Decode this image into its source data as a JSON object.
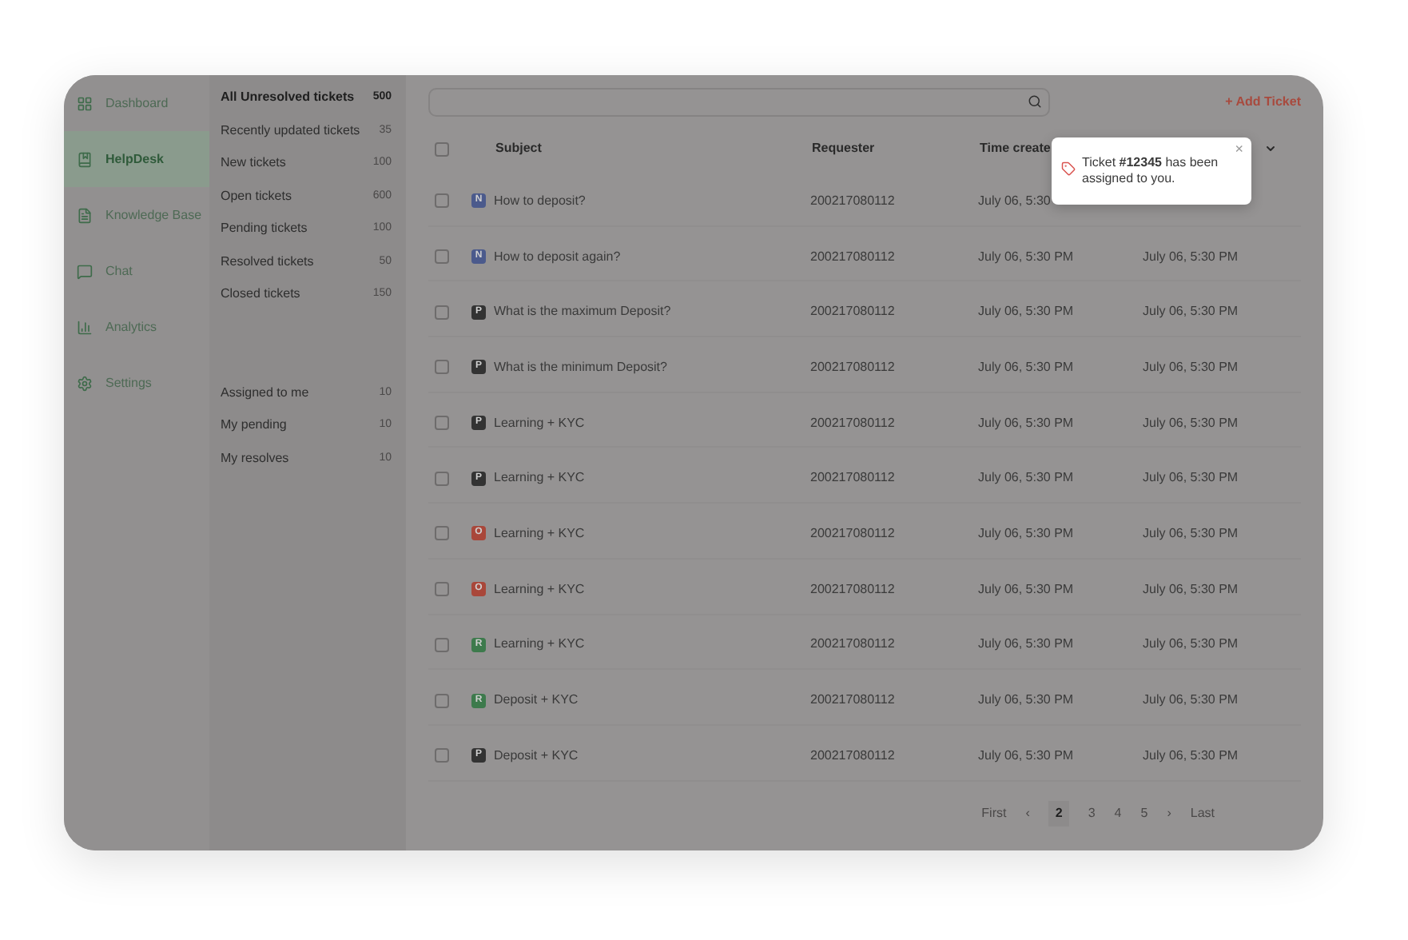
{
  "sidebar": {
    "items": [
      {
        "label": "Dashboard",
        "selected": false
      },
      {
        "label": "HelpDesk",
        "selected": true
      },
      {
        "label": "Knowledge Base",
        "selected": false
      },
      {
        "label": "Chat",
        "selected": false
      },
      {
        "label": "Analytics",
        "selected": false
      },
      {
        "label": "Settings",
        "selected": false
      }
    ]
  },
  "views": {
    "groups": [
      [
        {
          "label": "All Unresolved tickets",
          "count": "500",
          "selected": true
        },
        {
          "label": "Recently updated tickets",
          "count": "35",
          "selected": false
        },
        {
          "label": "New tickets",
          "count": "100",
          "selected": false
        },
        {
          "label": "Open tickets",
          "count": "600",
          "selected": false
        },
        {
          "label": "Pending tickets",
          "count": "100",
          "selected": false
        },
        {
          "label": "Resolved tickets",
          "count": "50",
          "selected": false
        },
        {
          "label": "Closed tickets",
          "count": "150",
          "selected": false
        }
      ],
      [
        {
          "label": "Assigned to me",
          "count": "10",
          "selected": false
        },
        {
          "label": "My pending",
          "count": "10",
          "selected": false
        },
        {
          "label": "My resolves",
          "count": "10",
          "selected": false
        }
      ]
    ]
  },
  "add_button": "+ Add Ticket",
  "table": {
    "all_checked": false,
    "columns": [
      "Subject",
      "Requester",
      "Time create"
    ],
    "rows": [
      {
        "checked": false,
        "badge": "N",
        "color": "#4b5a8c",
        "subject": "How to deposit?",
        "requester": "200217080112",
        "created": "July 06, 5:30"
      },
      {
        "checked": false,
        "badge": "N",
        "color": "#4b5a8c",
        "subject": "How to deposit again?",
        "requester": "200217080112",
        "created": "July 06, 5:30 PM",
        "updated": "July 06, 5:30 PM"
      },
      {
        "checked": false,
        "badge": "P",
        "color": "#333333",
        "subject": "What is the maximum Deposit?",
        "requester": "200217080112",
        "created": "July 06, 5:30 PM",
        "updated": "July 06, 5:30 PM"
      },
      {
        "checked": false,
        "badge": "P",
        "color": "#333333",
        "subject": "What is the minimum Deposit?",
        "requester": "200217080112",
        "created": "July 06, 5:30 PM",
        "updated": "July 06, 5:30 PM"
      },
      {
        "checked": false,
        "badge": "P",
        "color": "#333333",
        "subject": "Learning + KYC",
        "requester": "200217080112",
        "created": "July 06, 5:30 PM",
        "updated": "July 06, 5:30 PM"
      },
      {
        "checked": false,
        "badge": "P",
        "color": "#333333",
        "subject": "Learning + KYC",
        "requester": "200217080112",
        "created": "July 06, 5:30 PM",
        "updated": "July 06, 5:30 PM"
      },
      {
        "checked": false,
        "badge": "O",
        "color": "#a9473a",
        "subject": "Learning + KYC",
        "requester": "200217080112",
        "created": "July 06, 5:30 PM",
        "updated": "July 06, 5:30 PM"
      },
      {
        "checked": false,
        "badge": "O",
        "color": "#a9473a",
        "subject": "Learning + KYC",
        "requester": "200217080112",
        "created": "July 06, 5:30 PM",
        "updated": "July 06, 5:30 PM"
      },
      {
        "checked": false,
        "badge": "R",
        "color": "#3d7a4c",
        "subject": "Learning + KYC",
        "requester": "200217080112",
        "created": "July 06, 5:30 PM",
        "updated": "July 06, 5:30 PM"
      },
      {
        "checked": false,
        "badge": "R",
        "color": "#3d7a4c",
        "subject": "Deposit + KYC",
        "requester": "200217080112",
        "created": "July 06, 5:30 PM",
        "updated": "July 06, 5:30 PM"
      },
      {
        "checked": false,
        "badge": "P",
        "color": "#333333",
        "subject": "Deposit + KYC",
        "requester": "200217080112",
        "created": "July 06, 5:30 PM",
        "updated": "July 06, 5:30 PM"
      }
    ]
  },
  "pagination": {
    "first": "First",
    "prev": "‹",
    "pages": [
      {
        "label": "2",
        "selected": true
      },
      {
        "label": "3",
        "selected": false
      },
      {
        "label": "4",
        "selected": false
      },
      {
        "label": "5",
        "selected": false
      }
    ],
    "next": "›",
    "last": "Last"
  },
  "toast": {
    "message": "Ticket **#12345** has been assigned to you.",
    "close": "×"
  }
}
